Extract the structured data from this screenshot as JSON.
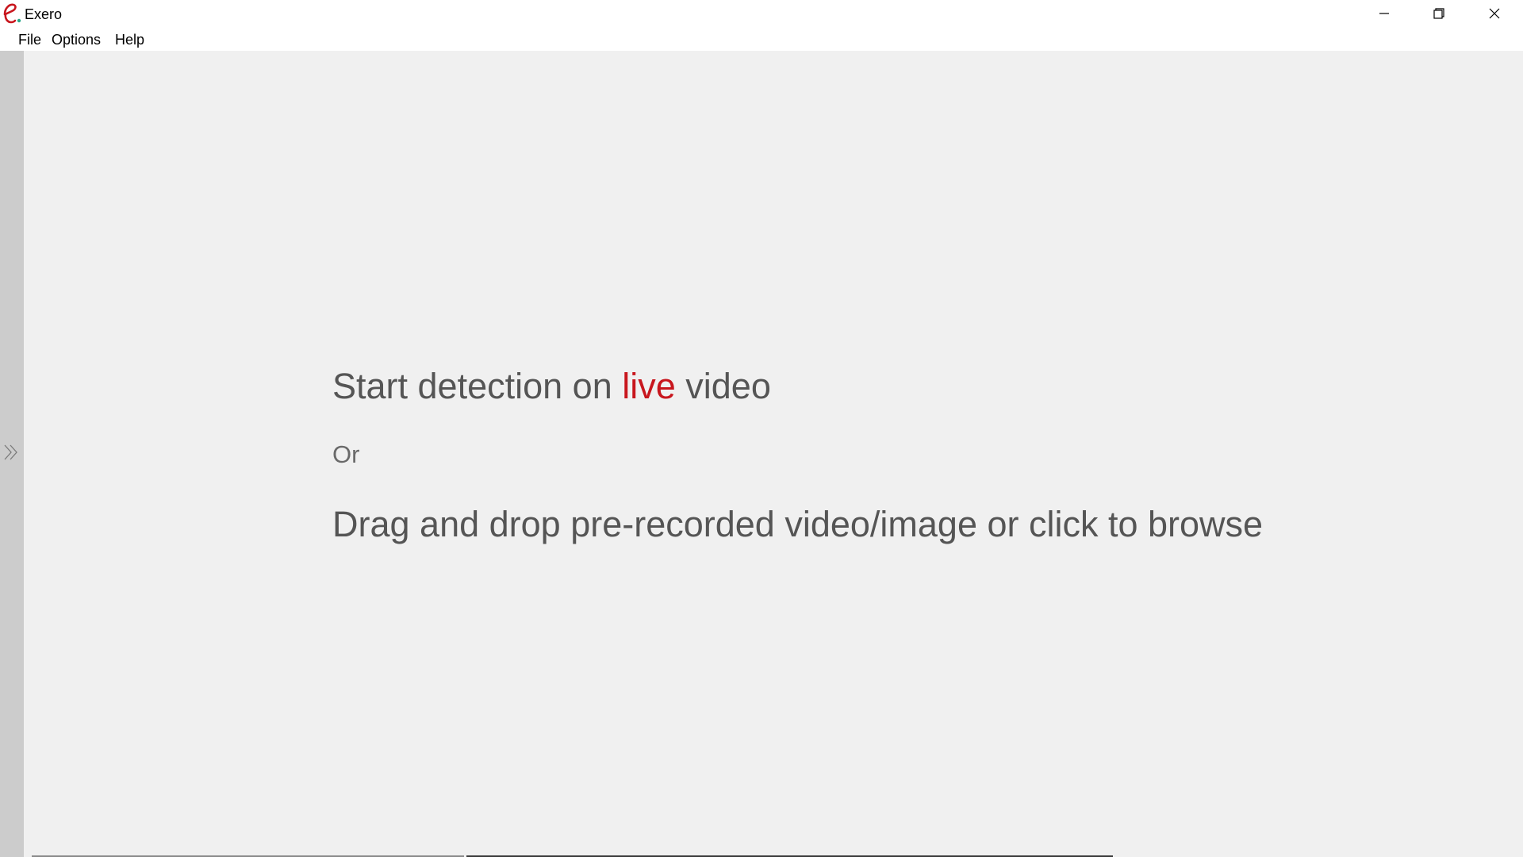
{
  "window": {
    "title": "Exero",
    "accent_color": "#c8161d",
    "icons": {
      "logo": "exero-logo-icon",
      "minimize": "minimize-icon",
      "maximize": "restore-icon",
      "close": "close-icon"
    }
  },
  "menubar": {
    "file": "File",
    "options": "Options",
    "help": "Help"
  },
  "sidebar": {
    "expand_icon": "double-chevron-right-icon"
  },
  "main": {
    "live_prefix": "Start detection on ",
    "live_word": "live",
    "live_suffix": " video",
    "or_text": "Or",
    "drop_text": "Drag and drop pre-recorded video/image or click to browse"
  }
}
